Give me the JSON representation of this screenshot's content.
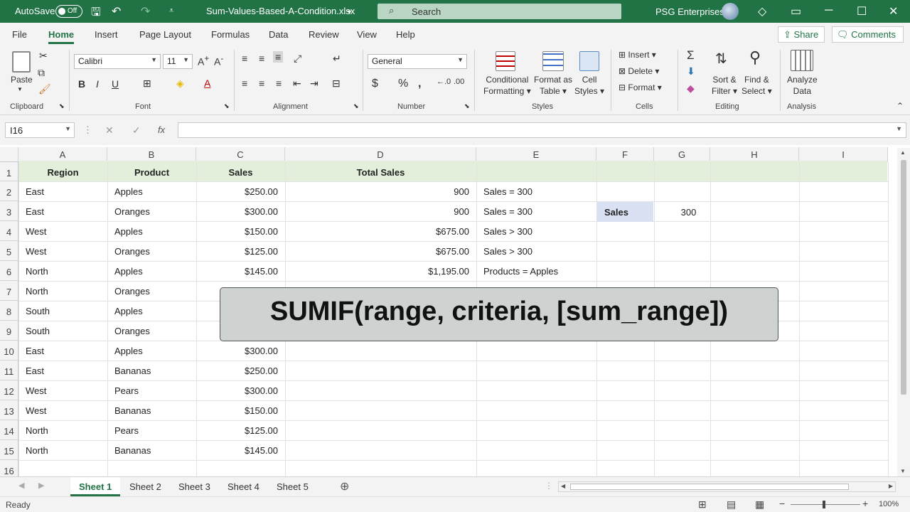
{
  "titlebar": {
    "autosave": "AutoSave",
    "toggle_state": "Off",
    "filename": "Sum-Values-Based-A-Condition.xlsx",
    "search_placeholder": "Search",
    "user": "PSG Enterprises"
  },
  "tabs": [
    "File",
    "Home",
    "Insert",
    "Page Layout",
    "Formulas",
    "Data",
    "Review",
    "View",
    "Help"
  ],
  "share": "Share",
  "comments": "Comments",
  "ribbon": {
    "clipboard": {
      "paste": "Paste",
      "label": "Clipboard"
    },
    "font": {
      "name": "Calibri",
      "size": "11",
      "label": "Font"
    },
    "alignment": {
      "label": "Alignment"
    },
    "number": {
      "format": "General",
      "label": "Number"
    },
    "styles": {
      "conditional": [
        "Conditional",
        "Formatting"
      ],
      "format_table": [
        "Format as",
        "Table"
      ],
      "cell_styles": [
        "Cell",
        "Styles"
      ],
      "label": "Styles"
    },
    "cells": {
      "insert": "Insert",
      "delete": "Delete",
      "format": "Format",
      "label": "Cells"
    },
    "editing": {
      "sort": [
        "Sort &",
        "Filter"
      ],
      "find": [
        "Find &",
        "Select"
      ],
      "label": "Editing"
    },
    "analysis": {
      "analyze": [
        "Analyze",
        "Data"
      ],
      "label": "Analysis"
    }
  },
  "namebox": "I16",
  "columns": [
    "A",
    "B",
    "C",
    "D",
    "E",
    "F",
    "G",
    "H",
    "I"
  ],
  "rows": [
    "1",
    "2",
    "3",
    "4",
    "5",
    "6",
    "7",
    "8",
    "9",
    "10",
    "11",
    "12",
    "13",
    "14",
    "15",
    "16"
  ],
  "headers": {
    "region": "Region",
    "product": "Product",
    "sales": "Sales",
    "total": "Total Sales"
  },
  "data": [
    {
      "region": "East",
      "product": "Apples",
      "sales": "$250.00",
      "total": "900",
      "note": "Sales = 300"
    },
    {
      "region": "East",
      "product": "Oranges",
      "sales": "$300.00",
      "total": "900",
      "note": "Sales = 300"
    },
    {
      "region": "West",
      "product": "Apples",
      "sales": "$150.00",
      "total": "$675.00",
      "note": "Sales > 300"
    },
    {
      "region": "West",
      "product": "Oranges",
      "sales": "$125.00",
      "total": "$675.00",
      "note": "Sales > 300"
    },
    {
      "region": "North",
      "product": "Apples",
      "sales": "$145.00",
      "total": "$1,195.00",
      "note": "Products = Apples"
    },
    {
      "region": "North",
      "product": "Oranges",
      "sales": "",
      "total": "",
      "note": ""
    },
    {
      "region": "South",
      "product": "Apples",
      "sales": "",
      "total": "",
      "note": ""
    },
    {
      "region": "South",
      "product": "Oranges",
      "sales": "",
      "total": "",
      "note": ""
    },
    {
      "region": "East",
      "product": "Apples",
      "sales": "$300.00",
      "total": "",
      "note": ""
    },
    {
      "region": "East",
      "product": "Bananas",
      "sales": "$250.00",
      "total": "",
      "note": ""
    },
    {
      "region": "West",
      "product": "Pears",
      "sales": "$300.00",
      "total": "",
      "note": ""
    },
    {
      "region": "West",
      "product": "Bananas",
      "sales": "$150.00",
      "total": "",
      "note": ""
    },
    {
      "region": "North",
      "product": "Pears",
      "sales": "$125.00",
      "total": "",
      "note": ""
    },
    {
      "region": "North",
      "product": "Bananas",
      "sales": "$145.00",
      "total": "",
      "note": ""
    }
  ],
  "criteria": {
    "label": "Sales",
    "value": "300"
  },
  "overlay_text": "SUMIF(range, criteria, [sum_range])",
  "sheets": [
    "Sheet 1",
    "Sheet 2",
    "Sheet 3",
    "Sheet 4",
    "Sheet 5"
  ],
  "status": "Ready",
  "zoom": "100%",
  "colors": {
    "accent": "#217346",
    "header_band": "#e3efda",
    "selected_cell": "#d9e1f2"
  }
}
